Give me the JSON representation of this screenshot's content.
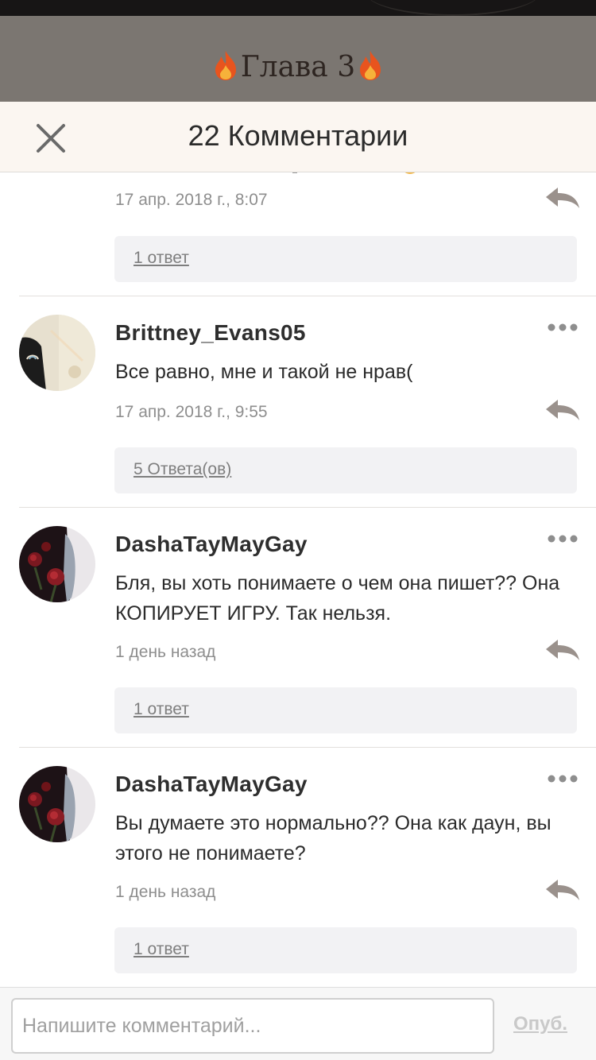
{
  "background": {
    "chapter_title": "Глава 3",
    "flame_icon": "fire-emoji"
  },
  "header": {
    "title": "22 Комментарии",
    "close_icon": "close-icon"
  },
  "comments": [
    {
      "time": "17 апр. 2018 г., 8:07",
      "replies_label": "1 ответ"
    },
    {
      "author": "Brittney_Evans05",
      "text": "Все равно, мне и такой не нрав(",
      "time": "17 апр. 2018 г., 9:55",
      "replies_label": "5 Ответа(ов)"
    },
    {
      "author": "DashaTayMayGay",
      "text": "Бля, вы хоть понимаете о чем она пишет?? Она КОПИРУЕТ ИГРУ. Так нельзя.",
      "time": "1 день назад",
      "replies_label": "1 ответ"
    },
    {
      "author": "DashaTayMayGay",
      "text": "Вы думаете это нормально?? Она как даун, вы этого не понимаете?",
      "time": "1 день назад",
      "replies_label": "1 ответ"
    }
  ],
  "composer": {
    "placeholder": "Напишите комментарий...",
    "publish_label": "Опуб."
  },
  "colors": {
    "header_bg": "#fbf6f1",
    "dim_overlay": "#7b7671",
    "reply_arrow": "#9a918c",
    "replies_box": "#f2f2f4"
  }
}
